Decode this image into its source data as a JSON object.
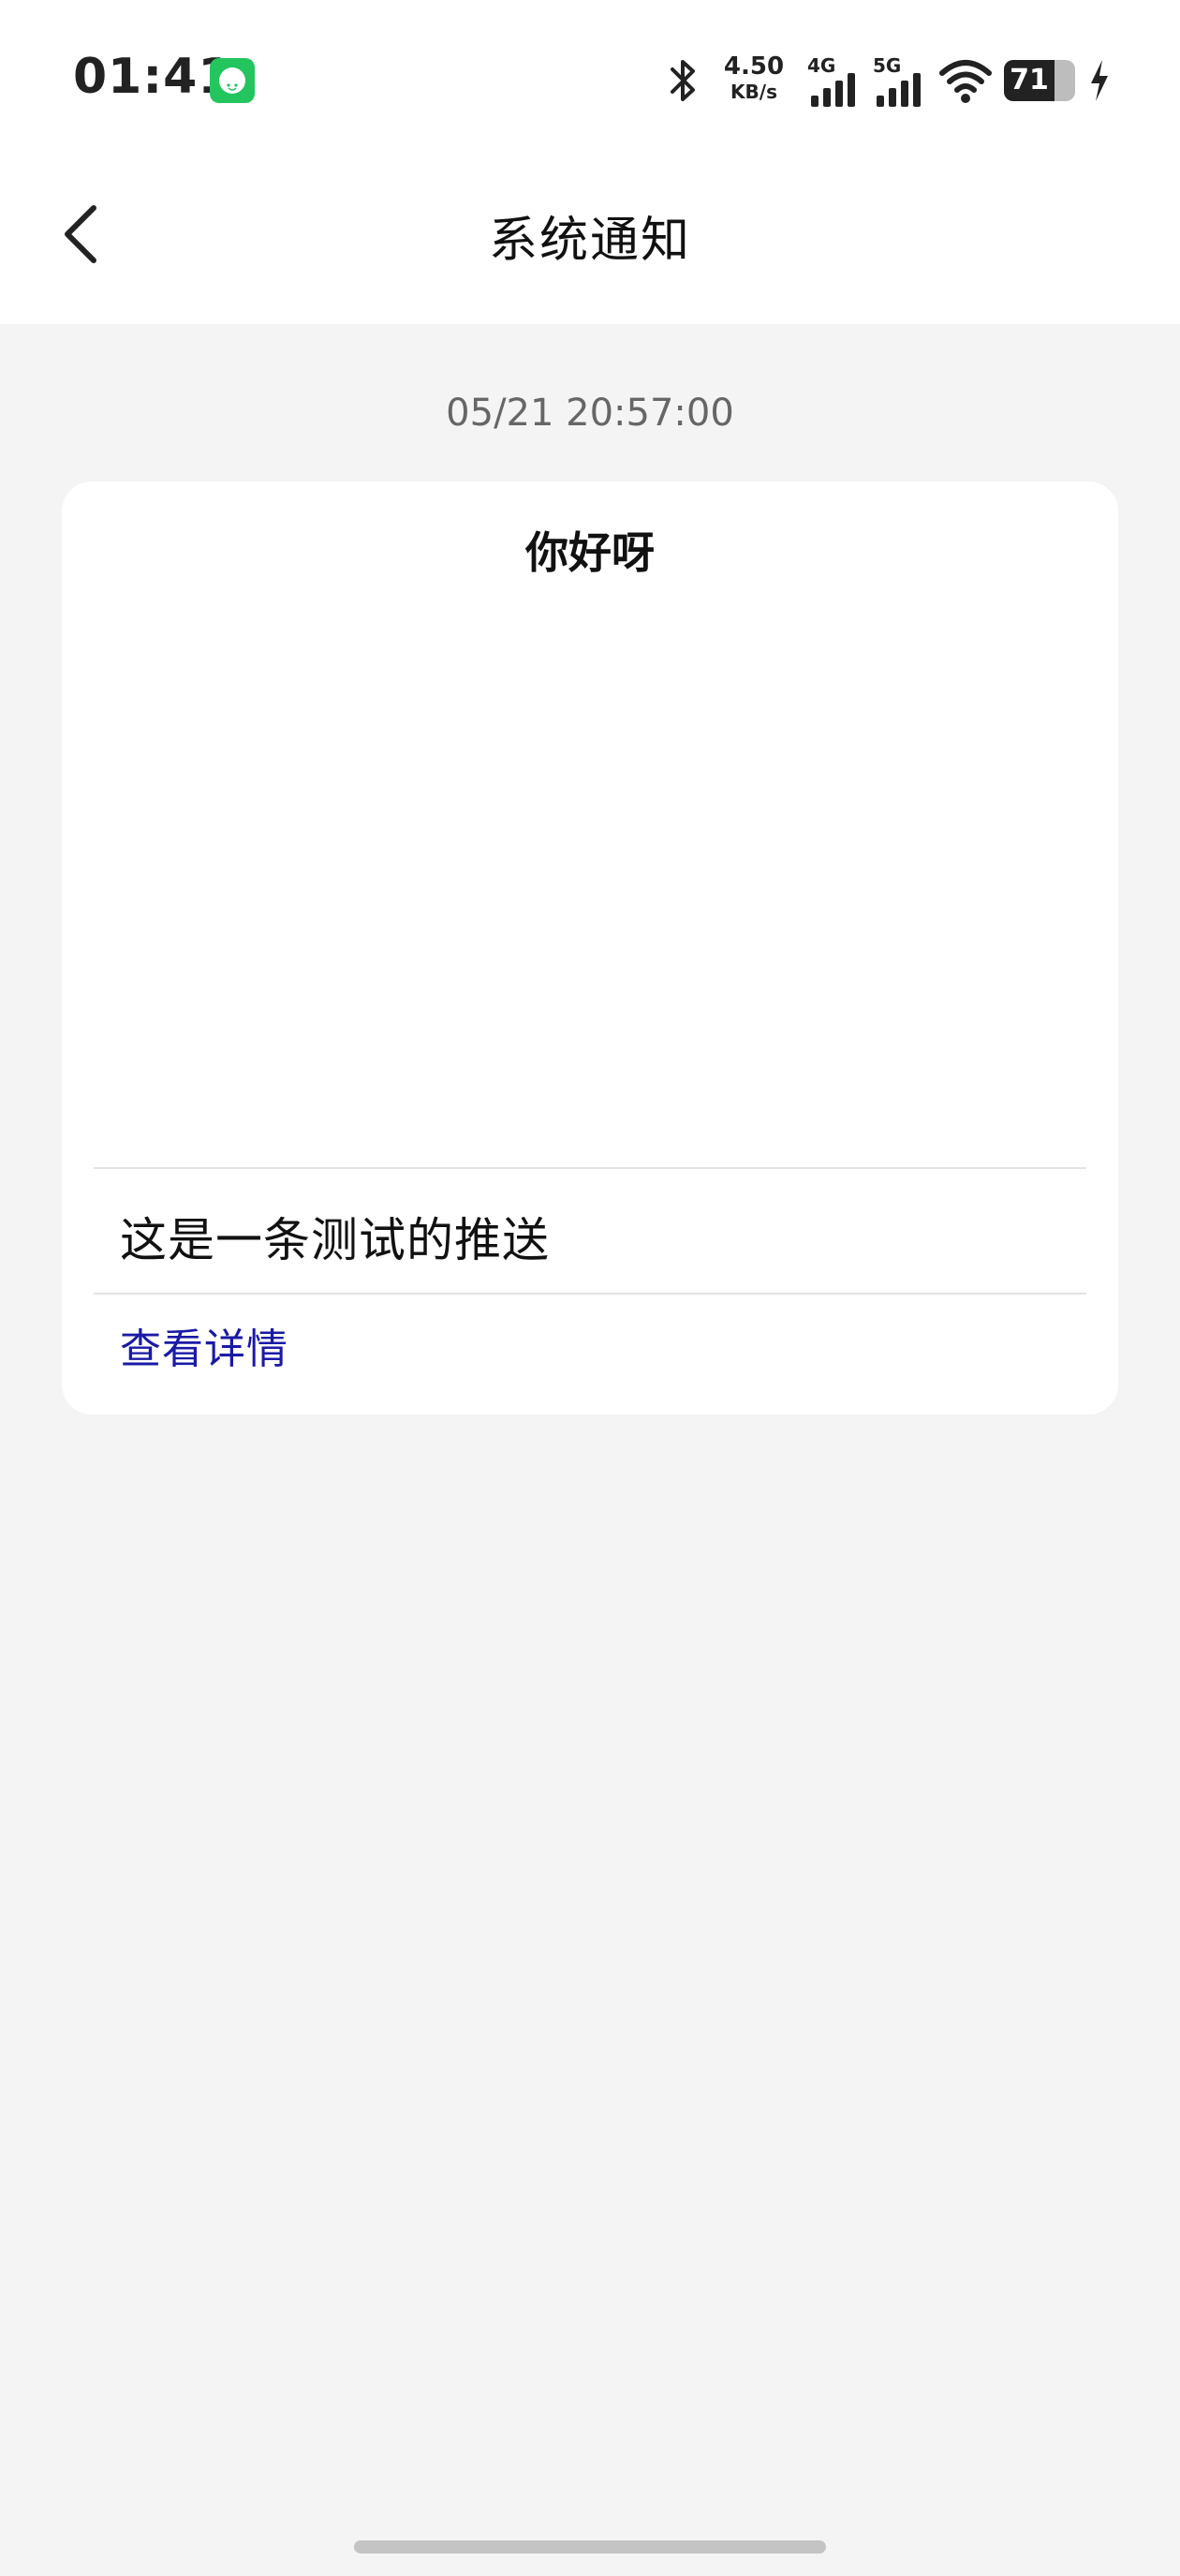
{
  "status_bar": {
    "time": "01:41",
    "net_speed_value": "4.50",
    "net_speed_unit": "KB/s",
    "signal_1_label": "4G",
    "signal_2_label": "5G",
    "battery_level": "71",
    "battery_fraction": 0.71,
    "icons": [
      "app-notification-icon",
      "bluetooth-icon",
      "signal-4g-icon",
      "signal-5g-icon",
      "wifi-icon",
      "battery-icon",
      "charging-icon"
    ]
  },
  "nav": {
    "title": "系统通知",
    "back_icon": "chevron-left-icon"
  },
  "notification": {
    "timestamp": "05/21 20:57:00",
    "title": "你好呀",
    "body": "这是一条测试的推送",
    "link_label": "查看详情",
    "link_color": "#1a1aa6"
  },
  "colors": {
    "background": "#f4f4f4",
    "card": "#ffffff",
    "app_icon": "#22c55e"
  }
}
